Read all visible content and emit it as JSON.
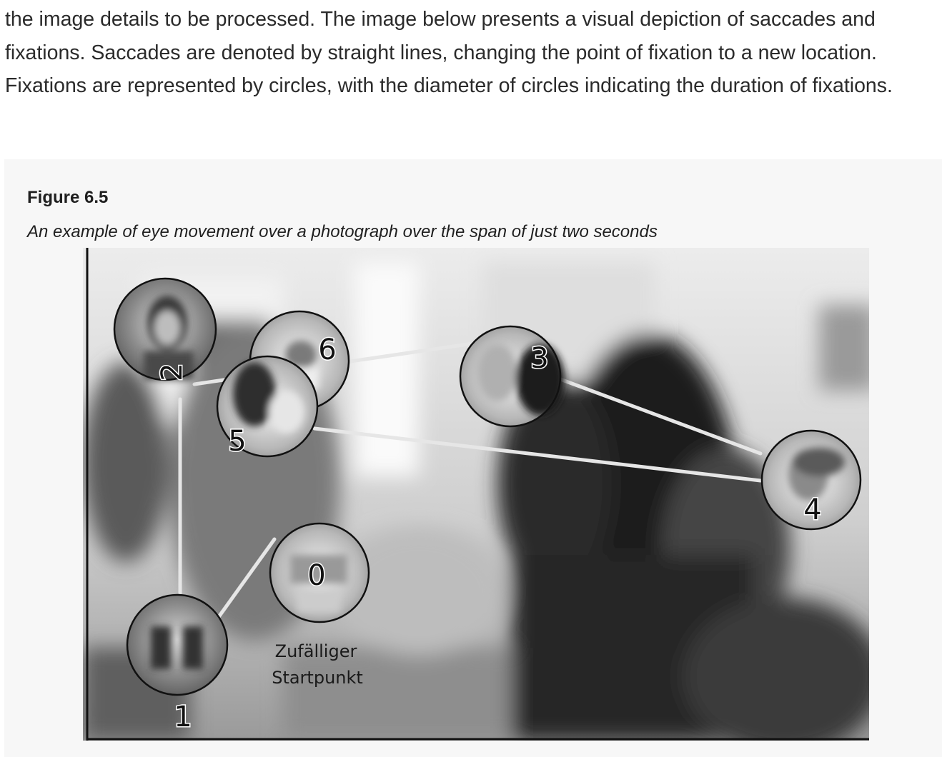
{
  "intro_text": "the image details to be processed. The image below presents a visual depiction of saccades and fixations. Saccades are denoted by straight lines, changing the point of fixation to a new location. Fixations are represented by circles, with the diameter of circles indicating the duration of fixations.",
  "figure": {
    "number": "Figure 6.5",
    "caption": "An example of eye movement over a photograph over the span of just two seconds",
    "photo": {
      "fixation_labels": [
        "0",
        "1",
        "2",
        "3",
        "4",
        "5",
        "6"
      ],
      "start_label_line1": "Zufälliger",
      "start_label_line2": "Startpunkt"
    }
  }
}
